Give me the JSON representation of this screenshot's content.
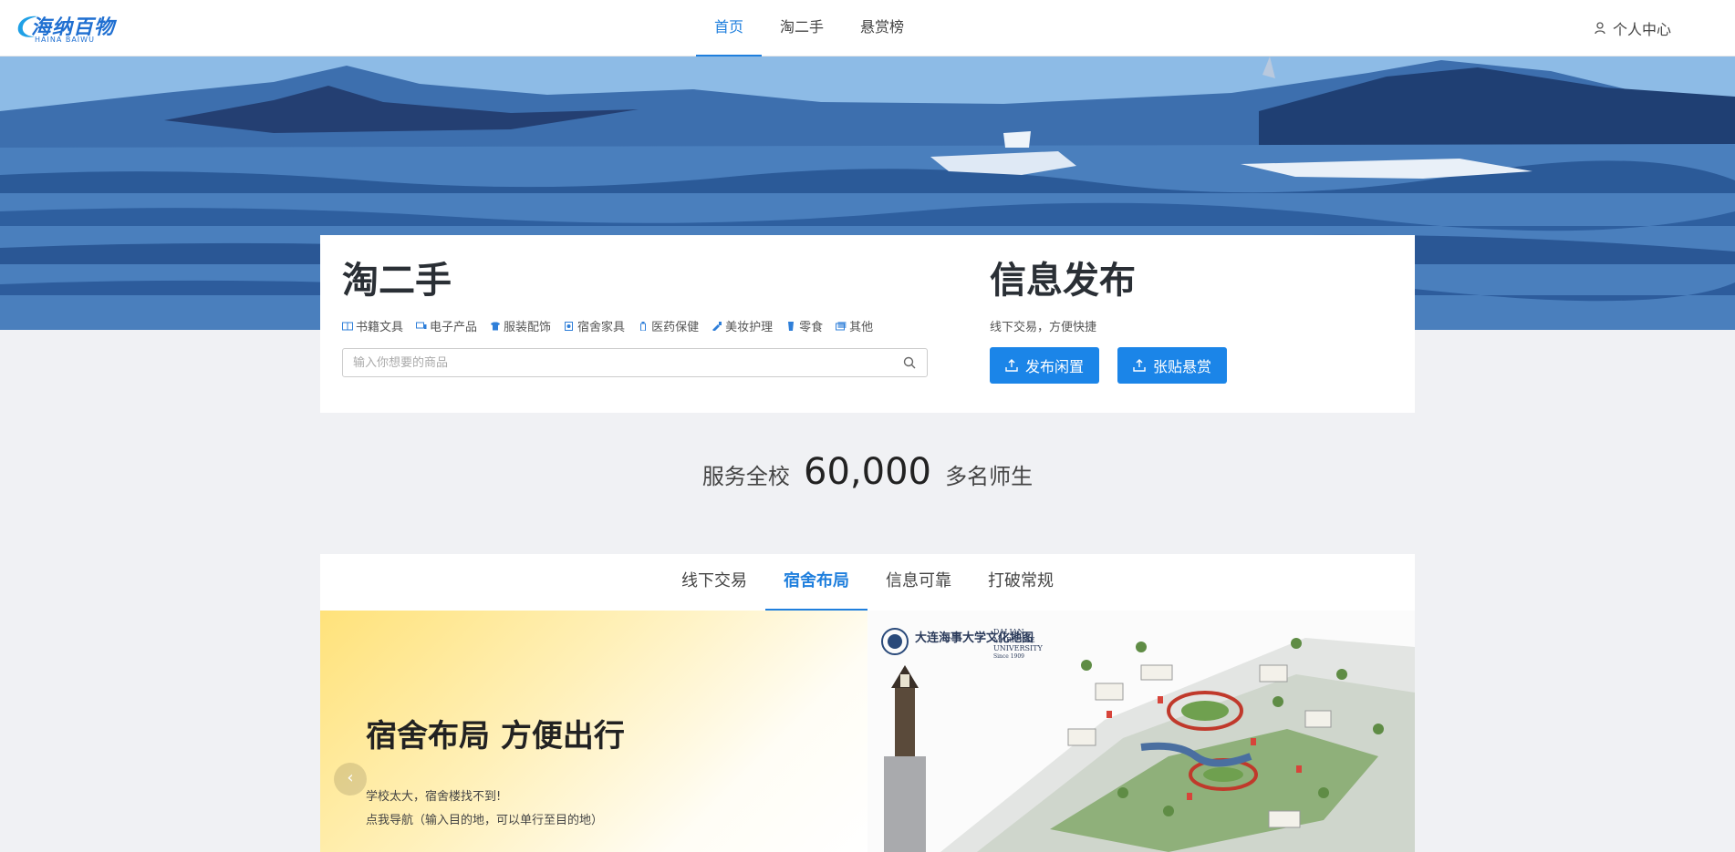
{
  "header": {
    "logo_text": "海纳百物",
    "logo_sub": "HAINA BAIWU",
    "nav": [
      "首页",
      "淘二手",
      "悬赏榜"
    ],
    "active_nav": "首页",
    "user_center": "个人中心"
  },
  "market": {
    "title": "淘二手",
    "categories": [
      {
        "label": "书籍文具",
        "icon": "book-icon"
      },
      {
        "label": "电子产品",
        "icon": "device-icon"
      },
      {
        "label": "服装配饰",
        "icon": "shirt-icon"
      },
      {
        "label": "宿舍家具",
        "icon": "furniture-icon"
      },
      {
        "label": "医药保健",
        "icon": "medicine-icon"
      },
      {
        "label": "美妆护理",
        "icon": "makeup-icon"
      },
      {
        "label": "零食",
        "icon": "snack-icon"
      },
      {
        "label": "其他",
        "icon": "other-icon"
      }
    ],
    "search_placeholder": "输入你想要的商品"
  },
  "publish": {
    "title": "信息发布",
    "subtitle": "线下交易，方便快捷",
    "btn_idle": "发布闲置",
    "btn_reward": "张贴悬赏"
  },
  "stat": {
    "prefix": "服务全校",
    "number": "60,000",
    "suffix": "多名师生"
  },
  "features": {
    "tabs": [
      "线下交易",
      "宿舍布局",
      "信息可靠",
      "打破常规"
    ],
    "active_tab": "宿舍布局",
    "slide_title": "宿舍布局 方便出行",
    "slide_line1": "学校太大，宿舍楼找不到!",
    "slide_line2": "点我导航（输入目的地，可以单行至目的地）",
    "map_title_cn": "大连海事大学文化地图",
    "map_title_en1": "DALIAN",
    "map_title_en2": "MARITIME",
    "map_title_en3": "UNIVERSITY",
    "map_since": "Since 1909"
  },
  "colors": {
    "accent": "#1f7fdd",
    "button": "#1b85e8",
    "page_bg": "#f0f1f4"
  }
}
